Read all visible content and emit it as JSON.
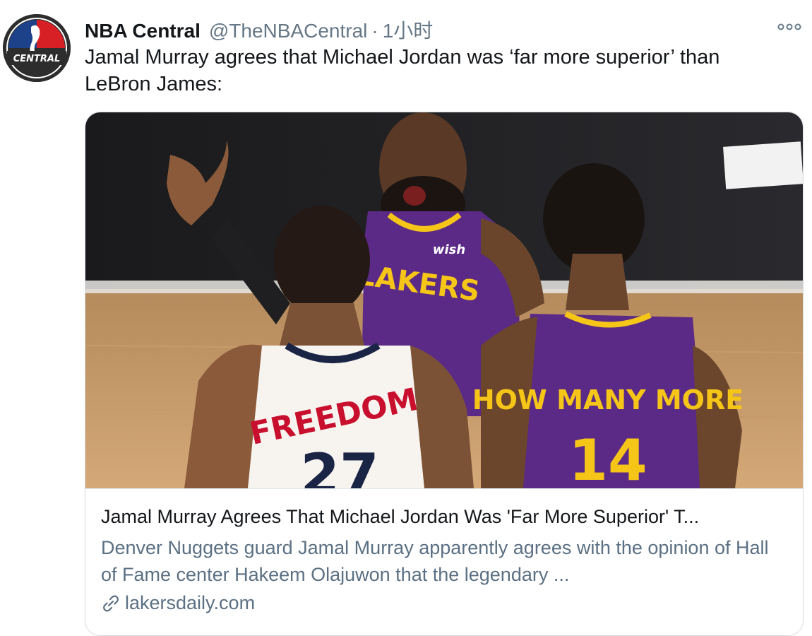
{
  "tweet": {
    "author_name": "NBA Central",
    "author_handle": "@TheNBACentral",
    "separator": "·",
    "timestamp": "1小时",
    "text": "Jamal Murray agrees that Michael Jordan was ‘far more superior’ than LeBron James:",
    "more_icon": "more-dots-icon"
  },
  "avatar": {
    "logo_text": "CENTRAL"
  },
  "card": {
    "image_jersey_text_white": "FREEDOM",
    "image_jersey_number_white": "27",
    "image_jersey_text_purple": "HOW MANY MORE",
    "image_jersey_number_purple": "14",
    "image_jersey_text_center": "LAKERS",
    "image_sponsor_text": "wish",
    "title": "Jamal Murray Agrees That Michael Jordan Was 'Far More Superior' T...",
    "description": "Denver Nuggets guard Jamal Murray apparently agrees with the opinion of Hall of Fame center Hakeem Olajuwon that the legendary ...",
    "domain": "lakersdaily.com",
    "link_icon": "link-icon"
  },
  "colors": {
    "name": "#14171a",
    "muted": "#657786",
    "lakers_purple": "#5b2a86",
    "lakers_gold": "#f5c518",
    "nuggets_red": "#c8102e"
  }
}
